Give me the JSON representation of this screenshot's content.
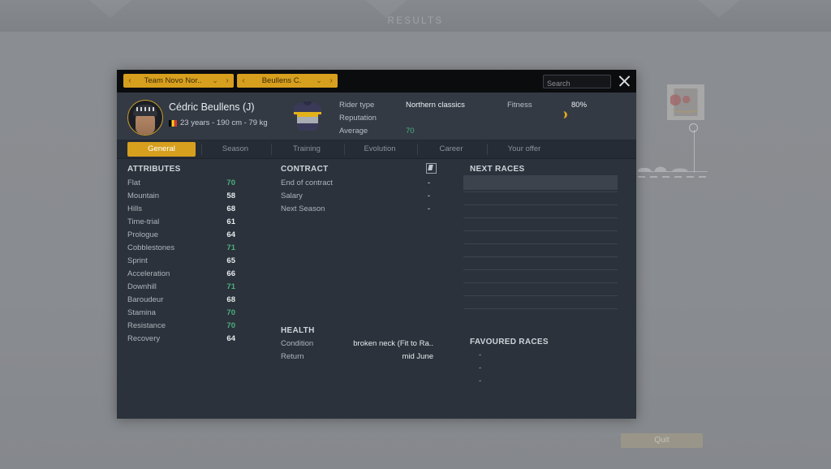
{
  "background": {
    "header_title": "RESULTS",
    "quit_label": "Quit"
  },
  "modal": {
    "nav": {
      "team_selector": {
        "label": "Team Novo Nor..",
        "prev_icon": "chevron-left-icon",
        "next_icon": "chevron-right-icon",
        "dropdown_icon": "chevron-down-icon"
      },
      "rider_selector": {
        "label": "Beullens C.",
        "prev_icon": "chevron-left-icon",
        "next_icon": "chevron-right-icon",
        "dropdown_icon": "chevron-down-icon"
      }
    },
    "search": {
      "value": "",
      "placeholder": "Search"
    },
    "close_icon": "close-icon",
    "rider": {
      "name": "Cédric Beullens (J)",
      "nationality_icon": "belgium-flag-icon",
      "meta": "23 years - 190 cm - 79 kg",
      "jersey_icon": "team-jersey-icon",
      "avatar_icon": "rider-avatar",
      "info": [
        {
          "label": "Rider type",
          "value": "Northern classics",
          "green": false
        },
        {
          "label": "Reputation",
          "value": "",
          "green": false
        },
        {
          "label": "Average",
          "value": "70",
          "green": true
        }
      ],
      "fitness": {
        "label": "Fitness",
        "value": "80%",
        "icon": "moon-phase-icon"
      }
    },
    "tabs": [
      {
        "label": "General",
        "active": true
      },
      {
        "label": "Season",
        "active": false
      },
      {
        "label": "Training",
        "active": false
      },
      {
        "label": "Evolution",
        "active": false
      },
      {
        "label": "Career",
        "active": false
      },
      {
        "label": "Your offer",
        "active": false
      }
    ],
    "attributes": {
      "title": "ATTRIBUTES",
      "rows": [
        {
          "label": "Flat",
          "value": "70",
          "green": true
        },
        {
          "label": "Mountain",
          "value": "58",
          "green": false
        },
        {
          "label": "Hills",
          "value": "68",
          "green": false
        },
        {
          "label": "Time-trial",
          "value": "61",
          "green": false
        },
        {
          "label": "Prologue",
          "value": "64",
          "green": false
        },
        {
          "label": "Cobblestones",
          "value": "71",
          "green": true
        },
        {
          "label": "Sprint",
          "value": "65",
          "green": false
        },
        {
          "label": "Acceleration",
          "value": "66",
          "green": false
        },
        {
          "label": "Downhill",
          "value": "71",
          "green": true
        },
        {
          "label": "Baroudeur",
          "value": "68",
          "green": false
        },
        {
          "label": "Stamina",
          "value": "70",
          "green": true
        },
        {
          "label": "Resistance",
          "value": "70",
          "green": true
        },
        {
          "label": "Recovery",
          "value": "64",
          "green": false
        }
      ]
    },
    "contract": {
      "title": "CONTRACT",
      "edit_icon": "edit-contract-icon",
      "rows": [
        {
          "label": "End of contract",
          "value": "-"
        },
        {
          "label": "Salary",
          "value": "-"
        },
        {
          "label": "Next Season",
          "value": "-"
        }
      ]
    },
    "health": {
      "title": "HEALTH",
      "rows": [
        {
          "label": "Condition",
          "value": "broken neck (Fit to Ra.."
        },
        {
          "label": "Return",
          "value": "mid June"
        }
      ]
    },
    "next_races": {
      "title": "NEXT RACES",
      "rows": [
        "",
        "",
        "",
        "",
        "",
        "",
        "",
        "",
        "",
        ""
      ]
    },
    "favoured_races": {
      "title": "FAVOURED RACES",
      "items": [
        "-",
        "-",
        "-"
      ]
    }
  },
  "colors": {
    "accent_gold": "#d79f1e",
    "panel_bg": "#2b323b",
    "green_value": "#4caf7d"
  }
}
